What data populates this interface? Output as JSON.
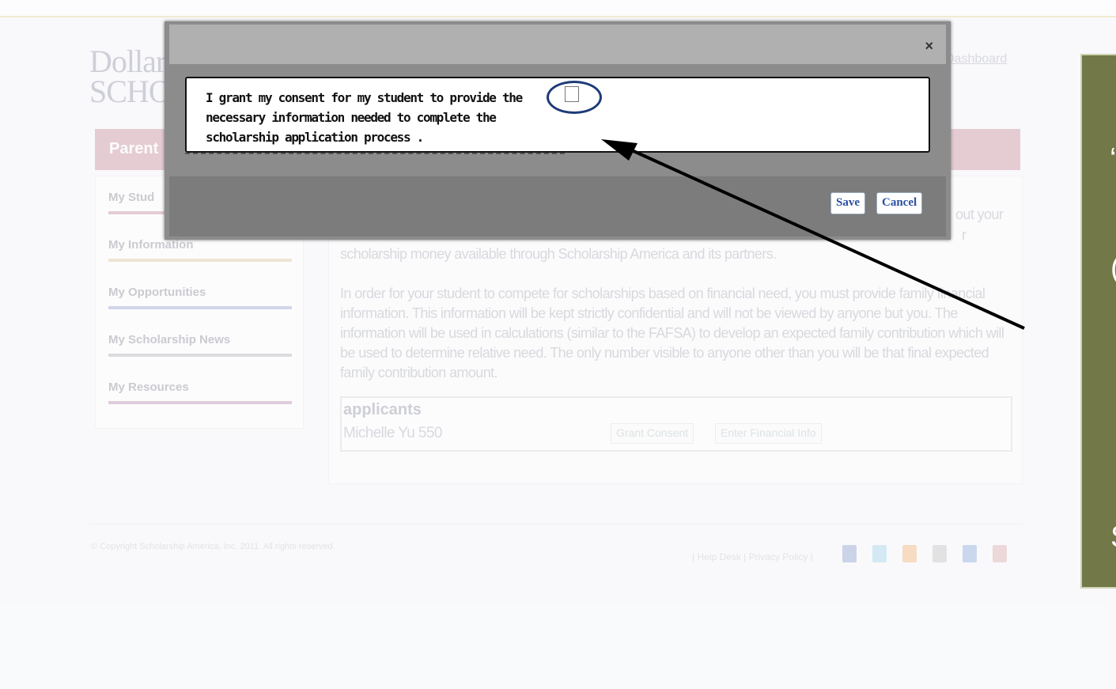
{
  "browser_strip": {
    "left_text": "",
    "right_text": ""
  },
  "logo": {
    "line1": "Dollars",
    "line2": "SCHO"
  },
  "header": {
    "dashboard_link": "Dashboard"
  },
  "banner": {
    "title": "Parent"
  },
  "sidebar": {
    "items": [
      {
        "label": "My Stud",
        "color": "#b26070"
      },
      {
        "label": "My Information",
        "color": "#d0b070"
      },
      {
        "label": "My Opportunities",
        "color": "#7080b8"
      },
      {
        "label": "My Scholarship News",
        "color": "#909098"
      },
      {
        "label": "My Resources",
        "color": "#a06090"
      }
    ]
  },
  "content": {
    "para1_tail_a": "out your",
    "para1_tail_b": "r",
    "para1_line3": "scholarship money available through Scholarship America and its partners.",
    "para2": "In order for your student to compete for scholarships based on financial need, you must provide family financial information. This information will be kept strictly confidential and will not be viewed by anyone but you. The information will be used in calculations (similar to the FAFSA) to develop an expected family contribution which will be used to determine relative need. The only number visible to anyone other than you will be that final expected family contribution amount.",
    "applicants_title": "applicants",
    "applicant_name": "Michelle Yu 550",
    "grant_consent_label": "Grant Consent",
    "enter_financial_label": "Enter Financial Info"
  },
  "footer": {
    "copyright": "© Copyright Scholarship America, Inc. 2011. All rights reserved.",
    "links": "| Help Desk | Privacy Policy |"
  },
  "modal": {
    "close_label": "×",
    "consent_text": "I grant my consent for my student to provide the necessary information needed to complete the scholarship application process .",
    "save_label": "Save",
    "cancel_label": "Cancel",
    "checkbox_checked": false,
    "highlight_color": "#1e3a78"
  },
  "callout": {
    "chars": [
      "“",
      "(",
      "S"
    ],
    "color": "#727848"
  }
}
